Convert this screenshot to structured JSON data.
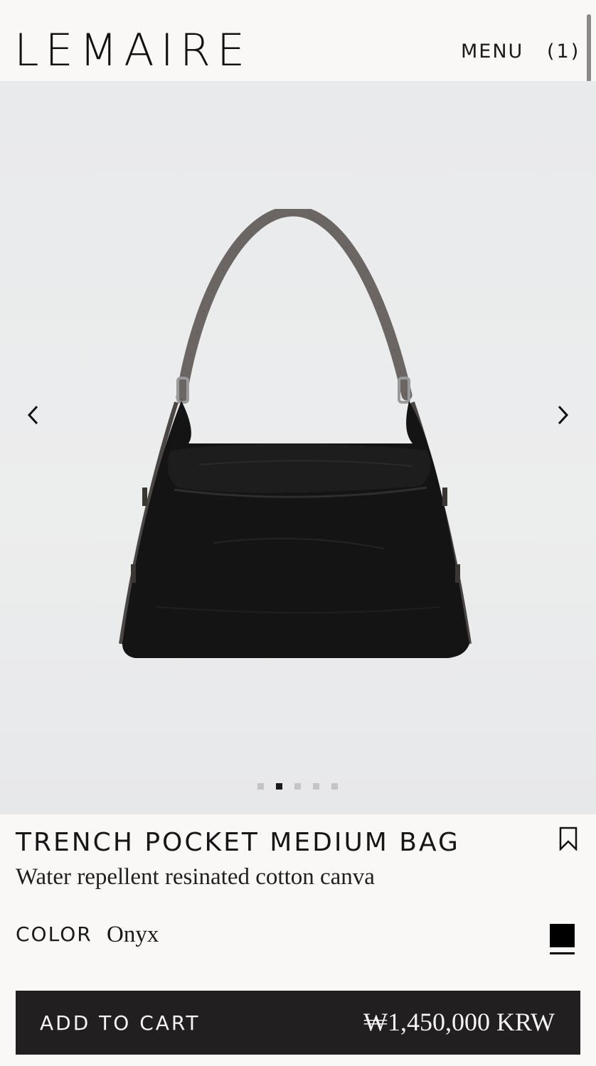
{
  "header": {
    "logo": "LEMAIRE",
    "menu_label": "MENU",
    "cart_count": "(1)"
  },
  "gallery": {
    "image_alt": "Trench Pocket Medium Bag in Onyx",
    "prev_icon": "chevron-left-icon",
    "next_icon": "chevron-right-icon",
    "slide_count": 5,
    "active_slide": 2
  },
  "product": {
    "title": "TRENCH POCKET MEDIUM BAG",
    "subtitle": "Water repellent resinated cotton canva",
    "bookmark_icon": "bookmark-icon",
    "color_label": "COLOR",
    "color_value": "Onyx",
    "swatch_color": "#000000"
  },
  "cart": {
    "label": "ADD TO CART",
    "price": "₩1,450,000 KRW",
    "bar_color": "#221f20"
  }
}
